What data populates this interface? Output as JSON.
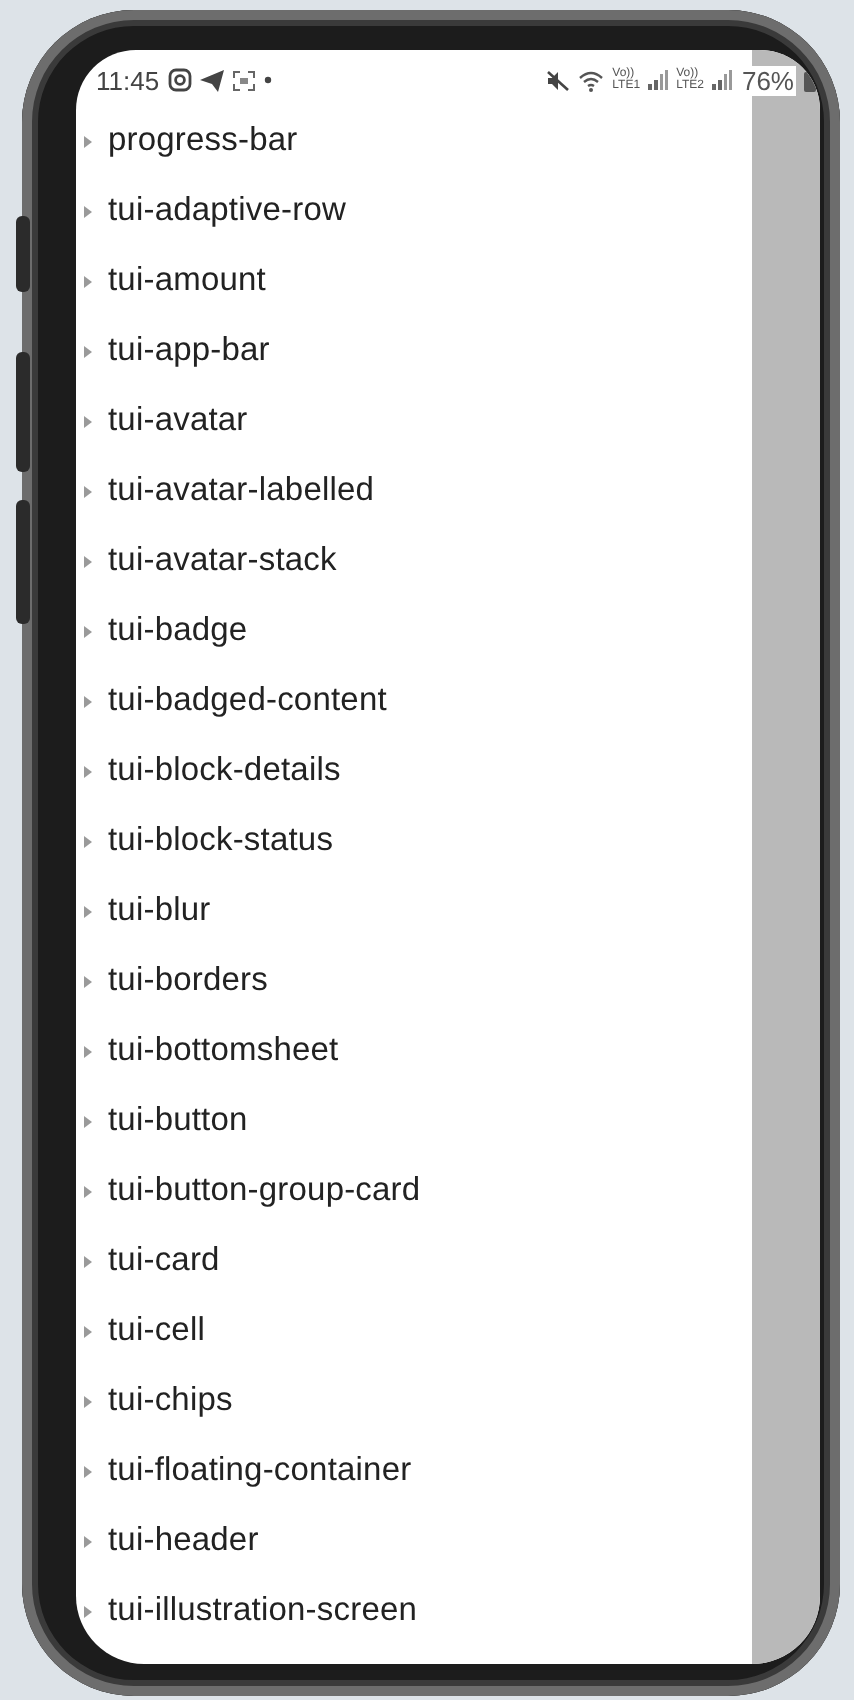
{
  "status_bar": {
    "time": "11:45",
    "sims": [
      {
        "top": "Vo))",
        "bottom": "LTE1"
      },
      {
        "top": "Vo))",
        "bottom": "LTE2"
      }
    ],
    "battery": "76%"
  },
  "list": {
    "items": [
      {
        "label": "progress-bar"
      },
      {
        "label": "tui-adaptive-row"
      },
      {
        "label": "tui-amount"
      },
      {
        "label": "tui-app-bar"
      },
      {
        "label": "tui-avatar"
      },
      {
        "label": "tui-avatar-labelled"
      },
      {
        "label": "tui-avatar-stack"
      },
      {
        "label": "tui-badge"
      },
      {
        "label": "tui-badged-content"
      },
      {
        "label": "tui-block-details"
      },
      {
        "label": "tui-block-status"
      },
      {
        "label": "tui-blur"
      },
      {
        "label": "tui-borders"
      },
      {
        "label": "tui-bottomsheet"
      },
      {
        "label": "tui-button"
      },
      {
        "label": "tui-button-group-card"
      },
      {
        "label": "tui-card"
      },
      {
        "label": "tui-cell"
      },
      {
        "label": "tui-chips"
      },
      {
        "label": "tui-floating-container"
      },
      {
        "label": "tui-header"
      },
      {
        "label": "tui-illustration-screen"
      }
    ]
  }
}
